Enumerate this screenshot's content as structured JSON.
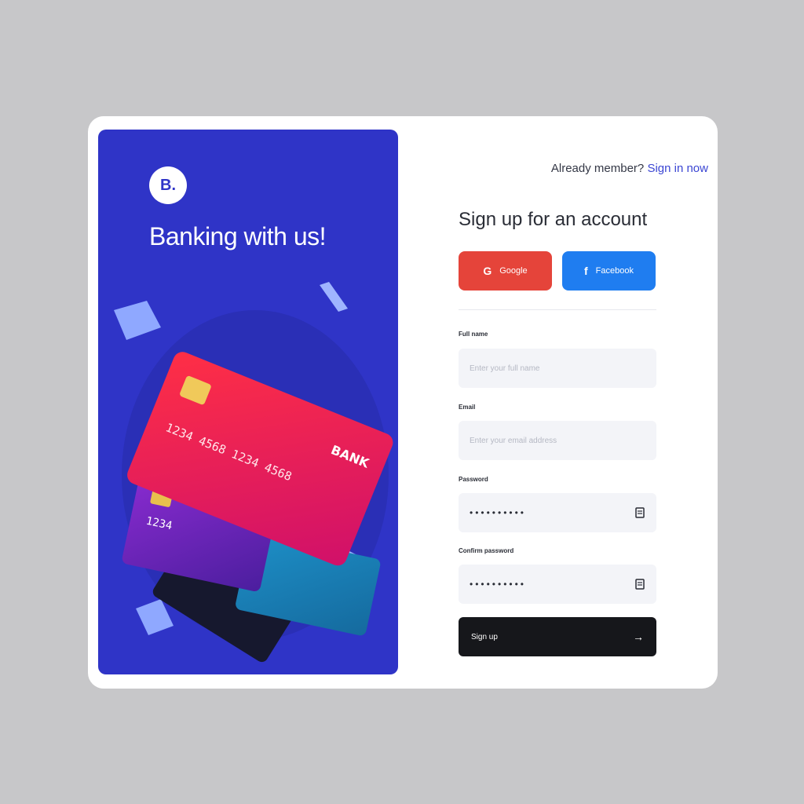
{
  "brand": {
    "logo_text": "B.",
    "headline": "Banking with us!"
  },
  "card_art": {
    "main_card": {
      "bank": "BANK",
      "number": "1234 4568 1234 4568"
    },
    "purple_card": {
      "number": "1234"
    }
  },
  "header": {
    "prompt": "Already member?",
    "signin_link": "Sign in now"
  },
  "form": {
    "title": "Sign up for an account",
    "google_label": "Google",
    "facebook_label": "Facebook",
    "fields": {
      "full_name": {
        "label": "Full name",
        "placeholder": "Enter your full name"
      },
      "email": {
        "label": "Email",
        "placeholder": "Enter your email address"
      },
      "password": {
        "label": "Password",
        "value": "••••••••••"
      },
      "confirm": {
        "label": "Confirm password",
        "value": "••••••••••"
      }
    },
    "submit_label": "Sign up",
    "submit_arrow": "→"
  },
  "colors": {
    "hero_bg": "#2f34c7",
    "google": "#e5443a",
    "facebook": "#1f7df0",
    "submit_bg": "#16171b",
    "link": "#3b46d3"
  },
  "icons": [
    "google-icon",
    "facebook-icon",
    "eye-icon",
    "arrow-right-icon"
  ]
}
